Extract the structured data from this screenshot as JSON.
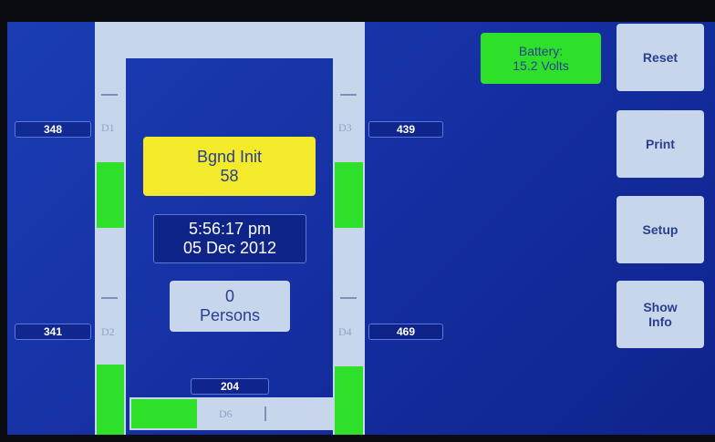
{
  "zones": {
    "d1": {
      "label": "D1",
      "value": "348"
    },
    "d2": {
      "label": "D2",
      "value": "341"
    },
    "d3": {
      "label": "D3",
      "value": "439"
    },
    "d4": {
      "label": "D4",
      "value": "469"
    },
    "d6": {
      "label": "D6",
      "value": "204"
    }
  },
  "status": {
    "bgnd_title": "Bgnd Init",
    "bgnd_value": "58",
    "time": "5:56:17 pm",
    "date": "05 Dec 2012",
    "persons_count": "0",
    "persons_label": "Persons"
  },
  "battery": {
    "line1": "Battery:",
    "line2": "15.2 Volts"
  },
  "buttons": {
    "reset": "Reset",
    "print": "Print",
    "setup": "Setup",
    "show_info_line1": "Show",
    "show_info_line2": "Info"
  },
  "colors": {
    "background": "#1636a8",
    "active_green": "#2ee02a",
    "inactive_strip": "#c8d6ec",
    "alert_yellow": "#f2ea2a"
  }
}
